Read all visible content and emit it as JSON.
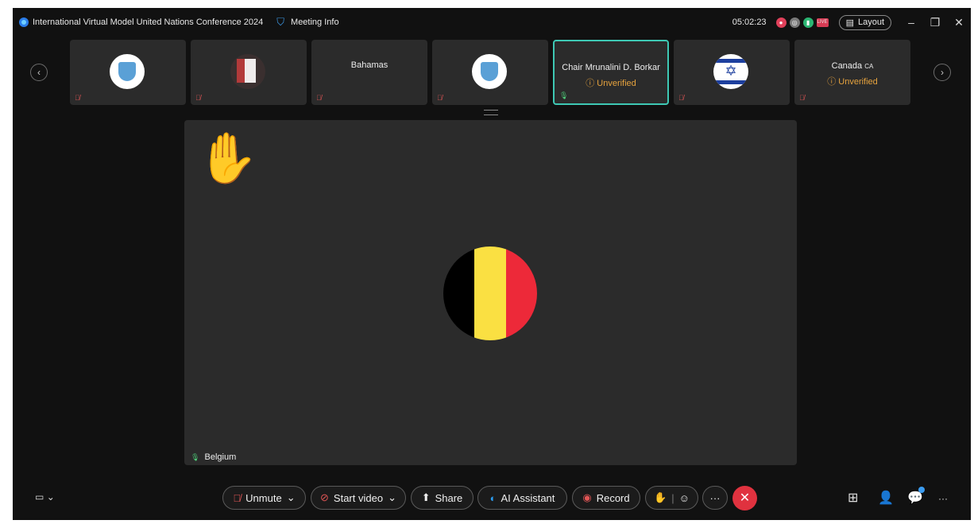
{
  "titlebar": {
    "meeting_name": "International Virtual Model United Nations Conference 2024",
    "meeting_info": "Meeting Info",
    "timer": "05:02:23",
    "live_badge": "LIVE",
    "layout_label": "Layout",
    "minimize": "–",
    "restore": "❐",
    "close": "✕"
  },
  "filmstrip": {
    "prev": "‹",
    "next": "›",
    "tiles": [
      {
        "type": "avatar",
        "avatar": "crest"
      },
      {
        "type": "avatar",
        "avatar": "japan-flag-photo"
      },
      {
        "type": "name",
        "name": "Bahamas"
      },
      {
        "type": "avatar",
        "avatar": "crest"
      },
      {
        "type": "name",
        "name": "Chair Mrunalini D. Borkar",
        "status": "Unverified",
        "active": true
      },
      {
        "type": "avatar",
        "avatar": "israel-flag"
      },
      {
        "type": "name",
        "name": "Canada",
        "suffix": "CA",
        "status": "Unverified"
      }
    ]
  },
  "stage": {
    "participant": "Belgium",
    "reaction": "raised-hand",
    "flag_colors": [
      "#000000",
      "#FAE042",
      "#ED2939"
    ]
  },
  "controls": {
    "unmute": "Unmute",
    "start_video": "Start video",
    "share": "Share",
    "ai_assistant": "AI Assistant",
    "record": "Record",
    "more": "···",
    "end": "✕"
  },
  "colors": {
    "accent_active": "#3EC8B4",
    "warning": "#E7A33E",
    "end_call": "#E0323F"
  }
}
